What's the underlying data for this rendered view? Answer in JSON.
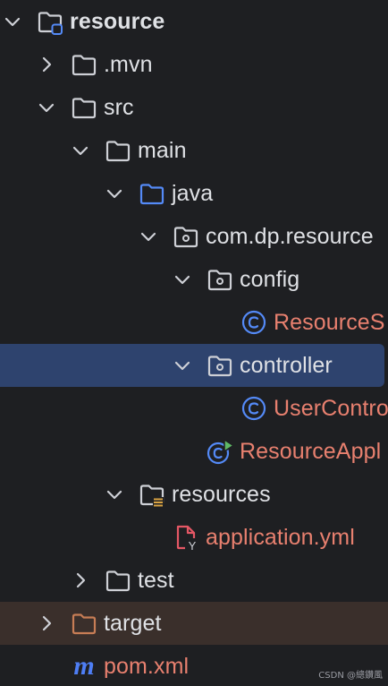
{
  "colors": {
    "background": "#1e1f22",
    "selected_row": "#2e436e",
    "excluded_row": "#3a2f2b",
    "text": "#dfe1e5",
    "class_text": "#e8806f",
    "folder_stroke": "#ced0d6",
    "source_folder": "#548af7",
    "excluded_folder": "#c77d55",
    "class_icon": "#548af7",
    "yaml_icon": "#e55765",
    "run_badge": "#5fb865",
    "resources_marker": "#d9a343",
    "maven_icon": "#4e7ef5"
  },
  "tree": [
    {
      "label": "resource",
      "depth": 0,
      "chevron": "down",
      "icon": "module-folder-icon",
      "style": "bold",
      "name": "tree-item-resource"
    },
    {
      "label": ".mvn",
      "depth": 1,
      "chevron": "right",
      "icon": "folder-icon",
      "name": "tree-item-mvn"
    },
    {
      "label": "src",
      "depth": 1,
      "chevron": "down",
      "icon": "folder-icon",
      "name": "tree-item-src"
    },
    {
      "label": "main",
      "depth": 2,
      "chevron": "down",
      "icon": "folder-icon",
      "name": "tree-item-main"
    },
    {
      "label": "java",
      "depth": 3,
      "chevron": "down",
      "icon": "source-folder-icon",
      "name": "tree-item-java"
    },
    {
      "label": "com.dp.resource",
      "depth": 4,
      "chevron": "down",
      "icon": "package-icon",
      "name": "tree-item-package"
    },
    {
      "label": "config",
      "depth": 5,
      "chevron": "down",
      "icon": "package-icon",
      "name": "tree-item-config"
    },
    {
      "label": "ResourceS",
      "depth": 6,
      "chevron": "none",
      "icon": "class-icon",
      "style": "orange",
      "name": "tree-item-resource-class"
    },
    {
      "label": "controller",
      "depth": 5,
      "chevron": "down",
      "icon": "package-icon",
      "selected": true,
      "name": "tree-item-controller"
    },
    {
      "label": "UserContro",
      "depth": 6,
      "chevron": "none",
      "icon": "class-icon",
      "style": "orange",
      "name": "tree-item-user-controller"
    },
    {
      "label": "ResourceAppl",
      "depth": 5,
      "chevron": "none",
      "icon": "spring-app-class-icon",
      "style": "orange",
      "name": "tree-item-resource-application"
    },
    {
      "label": "resources",
      "depth": 3,
      "chevron": "down",
      "icon": "resources-folder-icon",
      "name": "tree-item-resources"
    },
    {
      "label": "application.yml",
      "depth": 4,
      "chevron": "none",
      "icon": "yaml-file-icon",
      "style": "orange",
      "name": "tree-item-application-yml"
    },
    {
      "label": "test",
      "depth": 2,
      "chevron": "right",
      "icon": "folder-icon",
      "name": "tree-item-test"
    },
    {
      "label": "target",
      "depth": 1,
      "chevron": "right",
      "icon": "excluded-folder-icon",
      "excluded": true,
      "name": "tree-item-target"
    },
    {
      "label": "pom.xml",
      "depth": 1,
      "chevron": "none",
      "icon": "maven-icon",
      "style": "orange",
      "name": "tree-item-pom-xml"
    }
  ],
  "watermark": "CSDN @總鑽風"
}
